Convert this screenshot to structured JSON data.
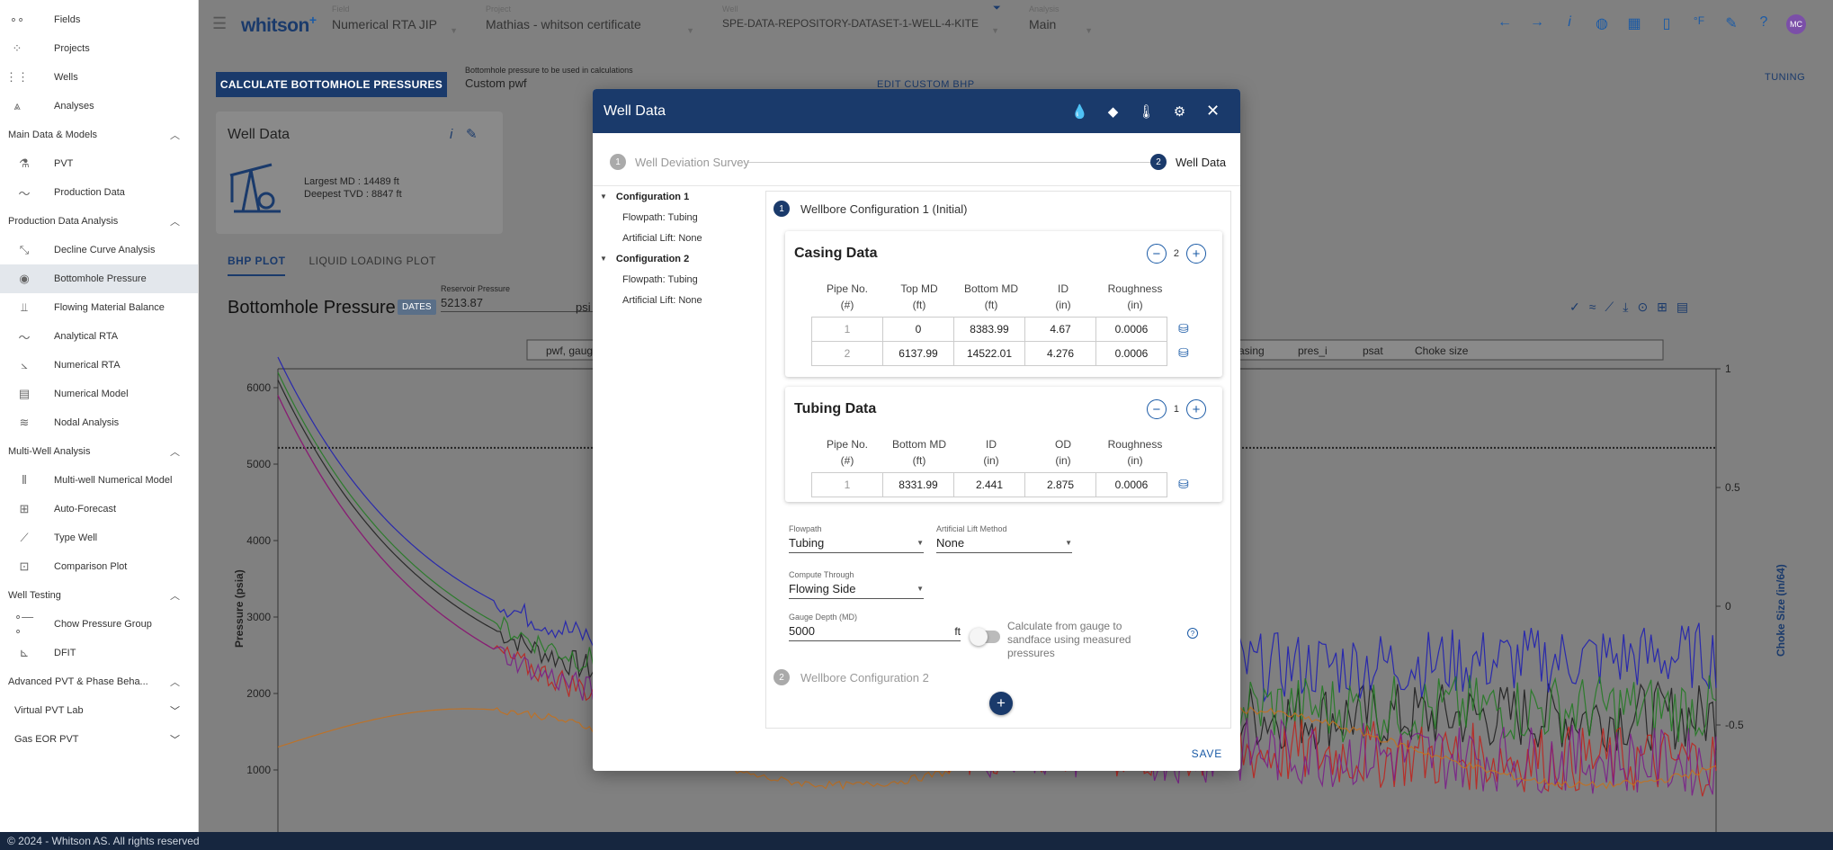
{
  "sidebar": {
    "top_items": [
      {
        "label": "Fields",
        "icon": "fields-icon"
      },
      {
        "label": "Projects",
        "icon": "projects-icon"
      },
      {
        "label": "Wells",
        "icon": "wells-icon"
      },
      {
        "label": "Analyses",
        "icon": "analyses-icon"
      }
    ],
    "sections": [
      {
        "title": "Main Data & Models",
        "items": [
          "PVT",
          "Production Data"
        ]
      },
      {
        "title": "Production Data Analysis",
        "items": [
          "Decline Curve Analysis",
          "Bottomhole Pressure",
          "Flowing Material Balance",
          "Analytical RTA",
          "Numerical RTA",
          "Numerical Model",
          "Nodal Analysis"
        ]
      },
      {
        "title": "Multi-Well Analysis",
        "items": [
          "Multi-well Numerical Model",
          "Auto-Forecast",
          "Type Well",
          "Comparison Plot"
        ]
      },
      {
        "title": "Well Testing",
        "items": [
          "Chow Pressure Group",
          "DFIT"
        ]
      }
    ],
    "advanced_title": "Advanced PVT & Phase Beha...",
    "virtual_pvt": "Virtual PVT Lab",
    "gas_eor": "Gas EOR PVT"
  },
  "topbar": {
    "brand": "whitson",
    "brand_plus": "+",
    "field_label": "Field",
    "field_value": "Numerical RTA JIP",
    "project_label": "Project",
    "project_value": "Mathias - whitson certificate",
    "well_label": "Well",
    "well_value": "SPE-DATA-REPOSITORY-DATASET-1-WELL-4-KITE",
    "analysis_label": "Analysis",
    "analysis_value": "Main",
    "avatar": "MC",
    "temp_unit": "°F"
  },
  "page": {
    "calc_button": "CALCULATE BOTTOMHOLE PRESSURES",
    "bhp_label": "Bottomhole pressure to be used in calculations",
    "bhp_value": "Custom pwf",
    "edit_custom": "EDIT CUSTOM BHP",
    "tuning": "TUNING",
    "well_data_title": "Well Data",
    "largest_md": "Largest MD :  14489 ft",
    "deepest_tvd": "Deepest TVD :  8847 ft",
    "tab_bhp": "BHP PLOT",
    "tab_liquid": "LIQUID LOADING PLOT",
    "plot_title": "Bottomhole Pressure",
    "dates_btn": "DATES",
    "reservoir_label": "Reservoir Pressure",
    "reservoir_value": "5213.87",
    "psi_unit": "psi",
    "footer": "© 2024 - Whitson AS. All rights reserved"
  },
  "chart_data": {
    "type": "line",
    "ylabel": "Pressure (psia)",
    "y2label": "Choke Size (in/64)",
    "ylim": [
      0,
      6200
    ],
    "y2lim": [
      -0.8,
      1
    ],
    "yticks": [
      1000,
      2000,
      3000,
      4000,
      5000,
      6000
    ],
    "y2ticks": [
      1,
      0.5,
      0,
      -0.5
    ],
    "legend_left": "pwf, gauge",
    "legend_right": [
      "casing",
      "pres_i",
      "psat",
      "Choke size"
    ],
    "reservoir_line": 5213.87,
    "series": [
      {
        "color": "#1a1a1a"
      },
      {
        "color": "#1a1ab4"
      },
      {
        "color": "#1f7a1f"
      },
      {
        "color": "#c0201a"
      },
      {
        "color": "#7a1a8a"
      },
      {
        "color": "#c7701a"
      }
    ]
  },
  "modal": {
    "title": "Well Data",
    "step1": "Well Deviation Survey",
    "step2": "Well Data",
    "tree": [
      {
        "config": "Configuration 1",
        "flowpath": "Flowpath: Tubing",
        "lift": "Artificial Lift: None"
      },
      {
        "config": "Configuration 2",
        "flowpath": "Flowpath: Tubing",
        "lift": "Artificial Lift: None"
      }
    ],
    "wb1_title": "Wellbore Configuration 1 (Initial)",
    "wb2_title": "Wellbore Configuration 2",
    "casing": {
      "title": "Casing Data",
      "count": "2",
      "headers": [
        [
          "Pipe No.",
          "(#)"
        ],
        [
          "Top MD",
          "(ft)"
        ],
        [
          "Bottom MD",
          "(ft)"
        ],
        [
          "ID",
          "(in)"
        ],
        [
          "Roughness",
          "(in)"
        ]
      ],
      "rows": [
        [
          "1",
          "0",
          "8383.99",
          "4.67",
          "0.0006"
        ],
        [
          "2",
          "6137.99",
          "14522.01",
          "4.276",
          "0.0006"
        ]
      ]
    },
    "tubing": {
      "title": "Tubing Data",
      "count": "1",
      "headers": [
        [
          "Pipe No.",
          "(#)"
        ],
        [
          "Bottom MD",
          "(ft)"
        ],
        [
          "ID",
          "(in)"
        ],
        [
          "OD",
          "(in)"
        ],
        [
          "Roughness",
          "(in)"
        ]
      ],
      "rows": [
        [
          "1",
          "8331.99",
          "2.441",
          "2.875",
          "0.0006"
        ]
      ]
    },
    "flowpath_label": "Flowpath",
    "flowpath_value": "Tubing",
    "lift_label": "Artificial Lift Method",
    "lift_value": "None",
    "compute_label": "Compute Through",
    "compute_value": "Flowing Side",
    "gauge_label": "Gauge Depth (MD)",
    "gauge_value": "5000",
    "gauge_unit": "ft",
    "toggle_label": "Calculate from gauge to sandface using measured pressures",
    "save": "SAVE",
    "accent": "#1a3a6b"
  }
}
